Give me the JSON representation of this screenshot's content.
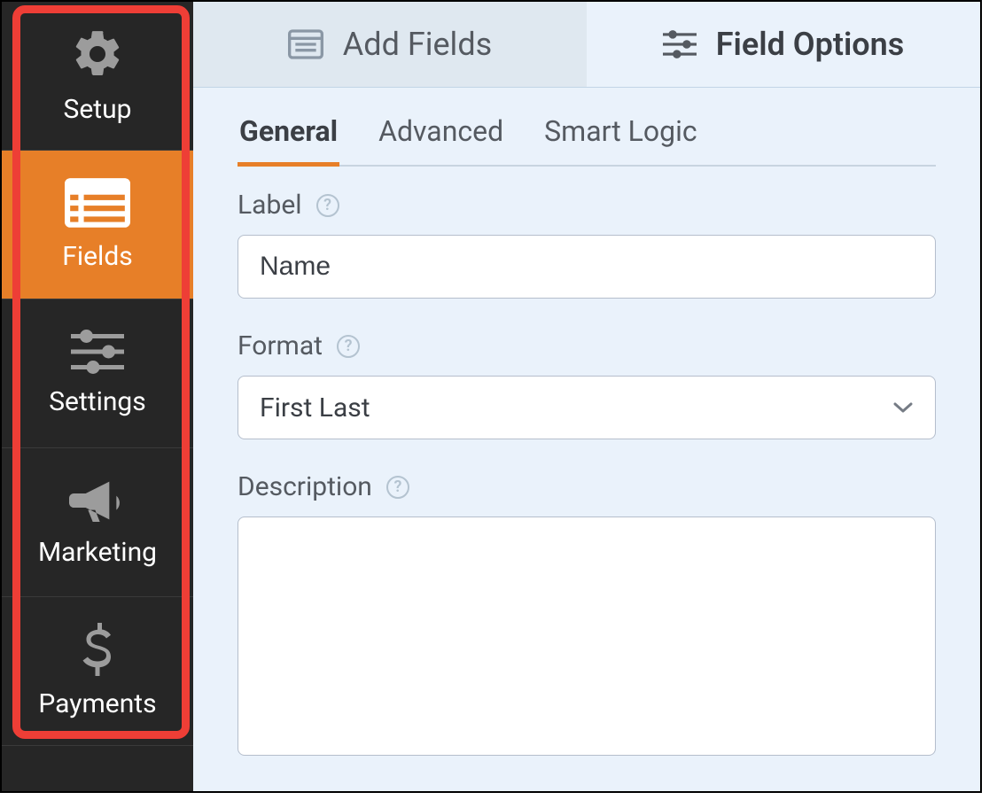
{
  "sidebar": {
    "items": [
      {
        "label": "Setup"
      },
      {
        "label": "Fields"
      },
      {
        "label": "Settings"
      },
      {
        "label": "Marketing"
      },
      {
        "label": "Payments"
      }
    ],
    "active_index": 1
  },
  "top_tabs": {
    "items": [
      {
        "label": "Add Fields"
      },
      {
        "label": "Field Options"
      }
    ],
    "active_index": 1
  },
  "sub_tabs": {
    "items": [
      {
        "label": "General"
      },
      {
        "label": "Advanced"
      },
      {
        "label": "Smart Logic"
      }
    ],
    "active_index": 0
  },
  "form": {
    "label_heading": "Label",
    "label_value": "Name",
    "format_heading": "Format",
    "format_value": "First Last",
    "description_heading": "Description",
    "description_value": ""
  }
}
